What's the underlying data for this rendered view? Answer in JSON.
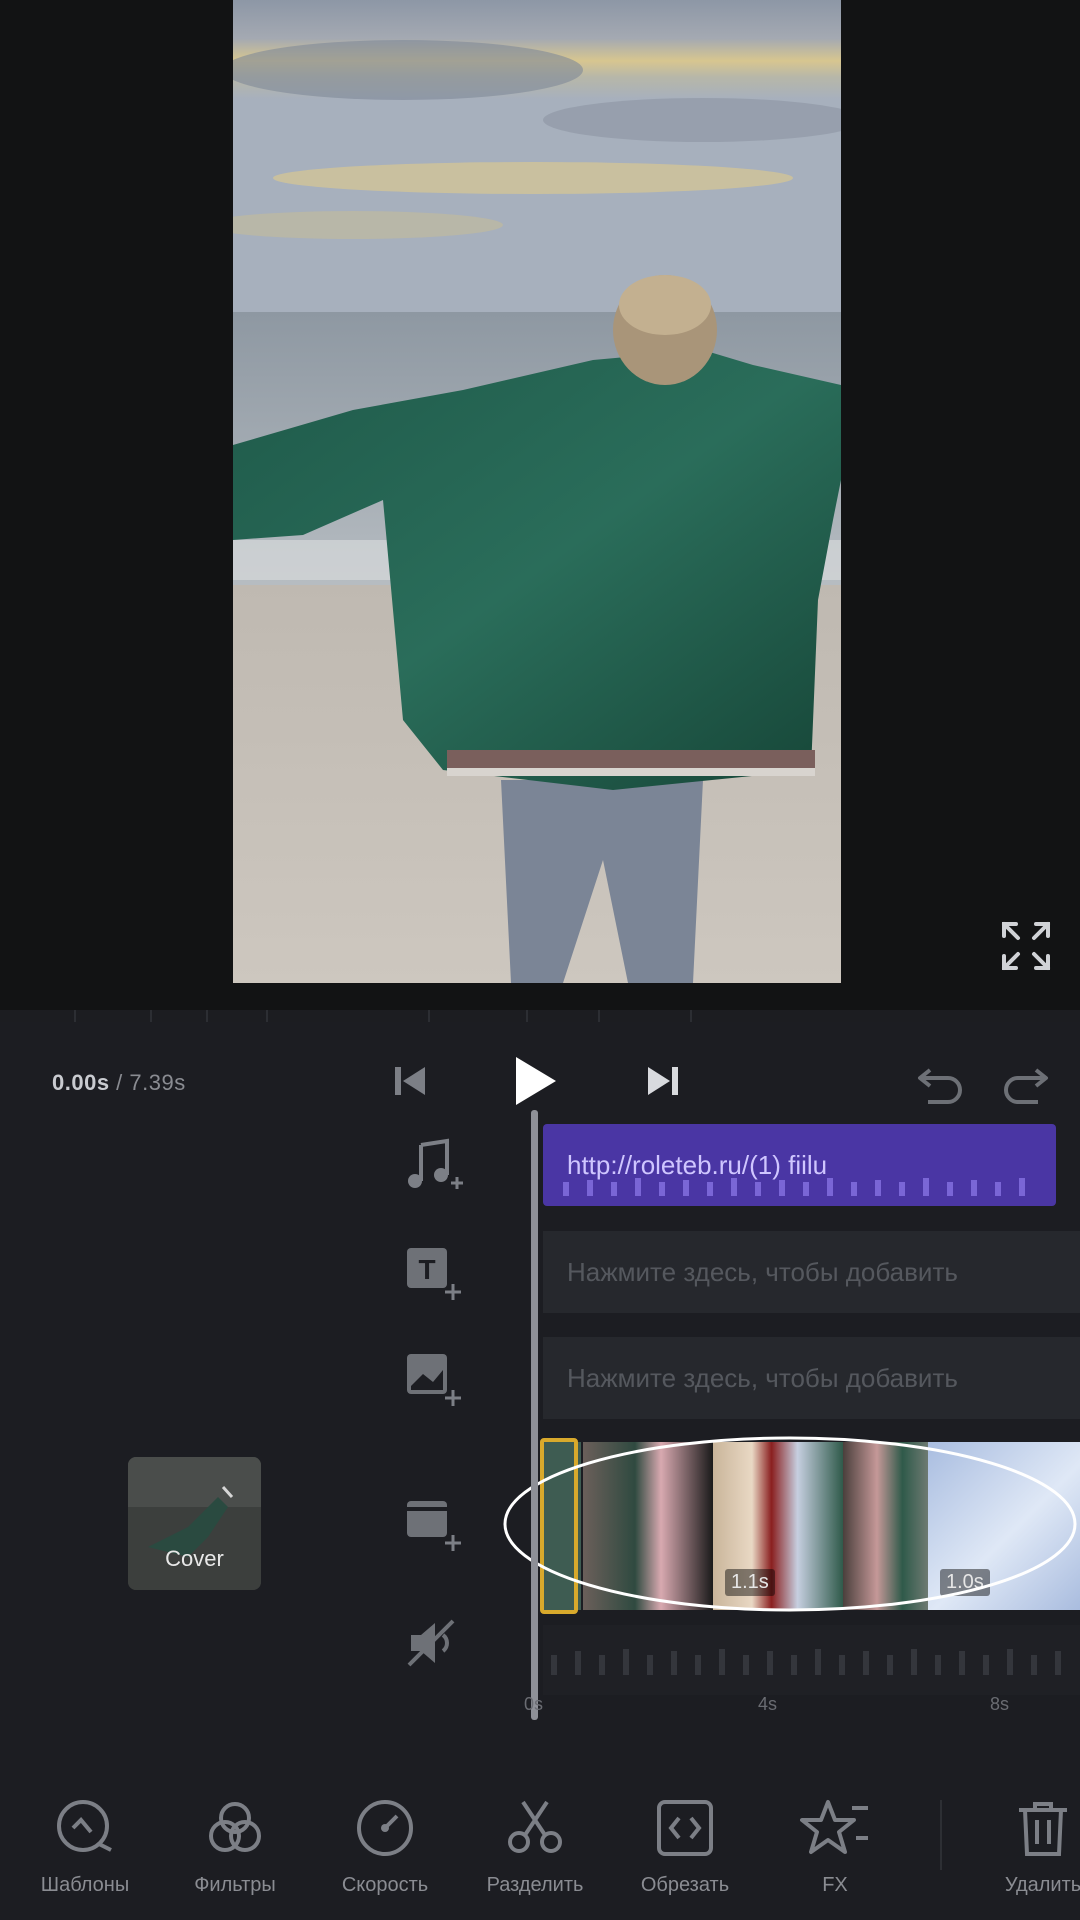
{
  "player": {
    "current_time": "0.00s",
    "separator": " / ",
    "total_time": "7.39s"
  },
  "tracks": {
    "music_label": "http://roleteb.ru/(1) fiilu",
    "text_placeholder": "Нажмите здесь, чтобы добавить",
    "sticker_placeholder": "Нажмите здесь, чтобы добавить",
    "cover_label": "Cover"
  },
  "clips": [
    {
      "duration": ""
    },
    {
      "duration": ""
    },
    {
      "duration": "1.1s"
    },
    {
      "duration": ""
    },
    {
      "duration": "1.0s"
    }
  ],
  "ruler": {
    "ticks": [
      "0s",
      "4s",
      "8s"
    ]
  },
  "toolbar": {
    "items": [
      {
        "label": "Шаблоны",
        "icon": "template-icon"
      },
      {
        "label": "Фильтры",
        "icon": "filters-icon"
      },
      {
        "label": "Скорость",
        "icon": "speed-icon"
      },
      {
        "label": "Разделить",
        "icon": "scissors-icon"
      },
      {
        "label": "Обрезать",
        "icon": "crop-icon"
      },
      {
        "label": "FX",
        "icon": "fx-star-icon"
      },
      {
        "label": "Удалить",
        "icon": "trash-icon"
      }
    ]
  },
  "colors": {
    "music_track": "#4a36a4",
    "selected_clip": "#d8a92c",
    "panel_bg": "#1c1d22"
  }
}
